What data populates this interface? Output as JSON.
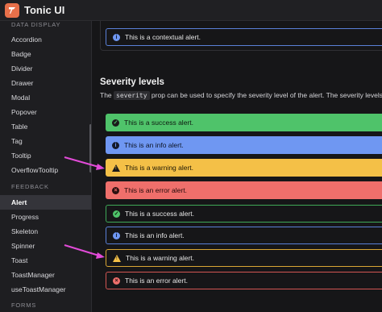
{
  "app": {
    "title": "Tonic UI"
  },
  "sidebar": {
    "section_data_display": "DATA DISPLAY",
    "data_display_items": [
      "Accordion",
      "Badge",
      "Divider",
      "Drawer",
      "Modal",
      "Popover",
      "Table",
      "Tag",
      "Tooltip",
      "OverflowTooltip"
    ],
    "section_feedback": "FEEDBACK",
    "feedback_items": [
      "Alert",
      "Progress",
      "Skeleton",
      "Spinner",
      "Toast",
      "ToastManager",
      "useToastManager"
    ],
    "section_forms": "FORMS",
    "active_item": "Alert"
  },
  "main": {
    "contextual_alert": "This is a contextual alert.",
    "heading": "Severity levels",
    "para_prefix": "The ",
    "para_code": "severity",
    "para_suffix": " prop can be used to specify the severity level of the alert. The severity levels are",
    "filled_alerts": [
      {
        "severity": "success",
        "text": "This is a success alert."
      },
      {
        "severity": "info",
        "text": "This is an info alert."
      },
      {
        "severity": "warning",
        "text": "This is a warning alert."
      },
      {
        "severity": "error",
        "text": "This is an error alert."
      }
    ],
    "outline_alerts": [
      {
        "severity": "success",
        "text": "This is a success alert."
      },
      {
        "severity": "info",
        "text": "This is an info alert."
      },
      {
        "severity": "warning",
        "text": "This is a warning alert."
      },
      {
        "severity": "error",
        "text": "This is an error alert."
      }
    ]
  },
  "colors": {
    "success": "#4fc36a",
    "info": "#6f97f2",
    "warning": "#f4c047",
    "error": "#ef6f6b",
    "annotation_arrow": "#e24bd8"
  },
  "icons": {
    "success": "check-circle-icon",
    "info": "info-circle-icon",
    "warning": "warning-triangle-icon",
    "error": "close-circle-icon"
  }
}
